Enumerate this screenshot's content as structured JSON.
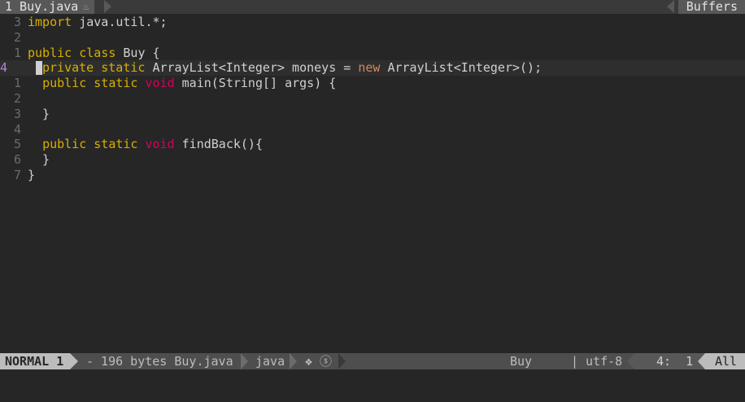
{
  "tabline": {
    "active_tab": "1 Buy.java",
    "active_tab_icon": "java-cup-icon",
    "buffers_label": "Buffers"
  },
  "editor": {
    "lines": [
      {
        "num": "3",
        "code": [
          {
            "t": "import",
            "c": "kw"
          },
          {
            "t": " java.util.*;"
          }
        ]
      },
      {
        "num": "2",
        "code": []
      },
      {
        "num": "1",
        "code": [
          {
            "t": "public",
            "c": "kw"
          },
          {
            "t": " "
          },
          {
            "t": "class",
            "c": "kw"
          },
          {
            "t": " Buy {"
          }
        ]
      },
      {
        "num": "4",
        "current": true,
        "code": [
          {
            "t": "private",
            "c": "kw"
          },
          {
            "t": " "
          },
          {
            "t": "static",
            "c": "kw"
          },
          {
            "t": " ArrayList<Integer> moneys = "
          },
          {
            "t": "new",
            "c": "new"
          },
          {
            "t": " ArrayList<Integer>();"
          }
        ]
      },
      {
        "num": "1",
        "code": [
          {
            "t": "  "
          },
          {
            "t": "public",
            "c": "kw"
          },
          {
            "t": " "
          },
          {
            "t": "static",
            "c": "kw"
          },
          {
            "t": " "
          },
          {
            "t": "void",
            "c": "ty"
          },
          {
            "t": " main(String[] args) {"
          }
        ]
      },
      {
        "num": "2",
        "code": []
      },
      {
        "num": "3",
        "code": [
          {
            "t": "  }"
          }
        ]
      },
      {
        "num": "4",
        "code": []
      },
      {
        "num": "5",
        "code": [
          {
            "t": "  "
          },
          {
            "t": "public",
            "c": "kw"
          },
          {
            "t": " "
          },
          {
            "t": "static",
            "c": "kw"
          },
          {
            "t": " "
          },
          {
            "t": "void",
            "c": "ty"
          },
          {
            "t": " findBack(){"
          }
        ]
      },
      {
        "num": "6",
        "code": [
          {
            "t": "  }"
          }
        ]
      },
      {
        "num": "7",
        "code": [
          {
            "t": "}"
          }
        ]
      }
    ]
  },
  "statusline": {
    "mode": "NORMAL 1",
    "file_info": "- 196 bytes Buy.java",
    "filetype": "java",
    "extra_icons": "❖ ⓢ",
    "tag": "Buy",
    "os_icon": "apple-icon",
    "encoding": "| utf-8",
    "position": "4:  1",
    "percent": "All"
  },
  "colors": {
    "background": "#262626",
    "keyword": "#d7af00",
    "type": "#d7005f",
    "new": "#d7875f",
    "line_number": "#6c6c6c",
    "current_line_number": "#af87d7",
    "statusline_bg": "#4e4e4e",
    "mode_bg": "#bcbcbc"
  }
}
